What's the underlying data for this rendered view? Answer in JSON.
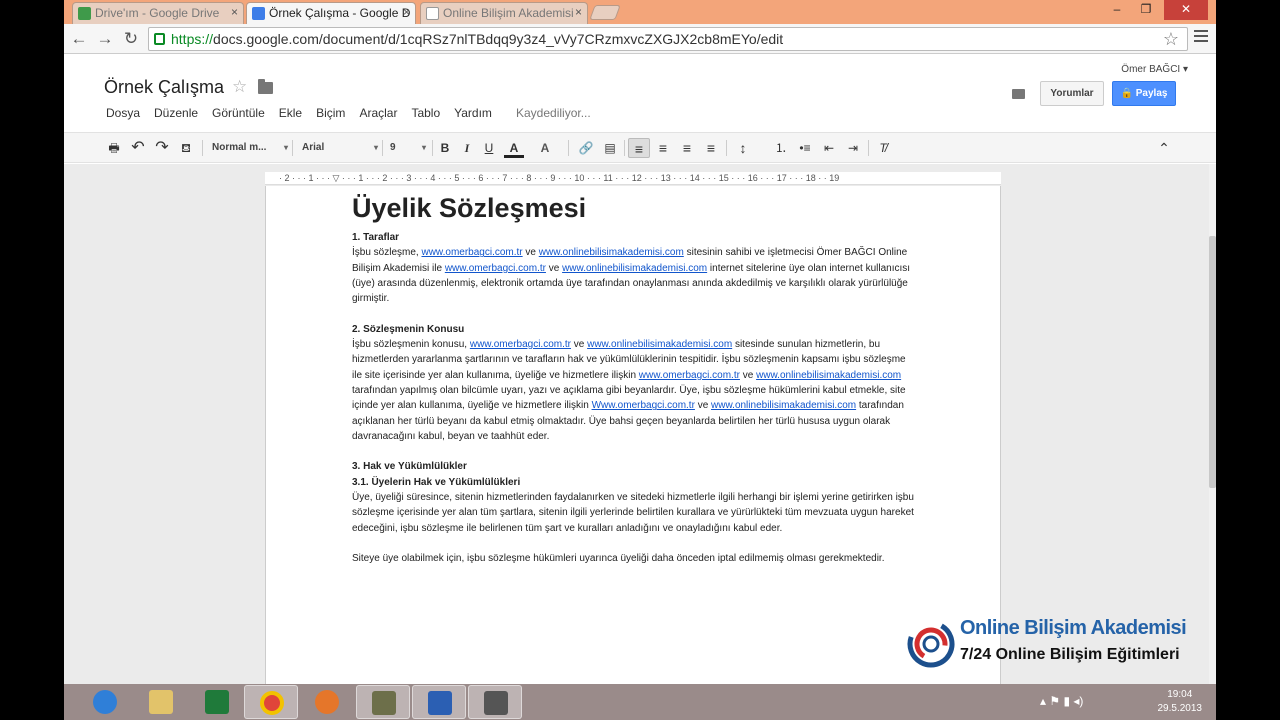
{
  "browser": {
    "tabs": [
      {
        "label": "Drive'ım - Google Drive",
        "close": "×"
      },
      {
        "label": "Örnek Çalışma - Google D",
        "close": "×"
      },
      {
        "label": "Online Bilişim Akademisi",
        "close": "×"
      }
    ],
    "window_controls": {
      "minimize": "–",
      "maximize": "❐",
      "close": "✕"
    },
    "nav": {
      "back": "←",
      "forward": "→",
      "reload": "↻"
    },
    "url_scheme": "https://",
    "url_rest": "docs.google.com/document/d/1cqRSz7nlTBdqq9y3z4_vVy7CRzmxvcZXGJX2cb8mEYo/edit",
    "bookmark_star": "☆"
  },
  "docs": {
    "title": "Örnek Çalışma",
    "title_star": "☆",
    "menu": [
      "Dosya",
      "Düzenle",
      "Görüntüle",
      "Ekle",
      "Biçim",
      "Araçlar",
      "Tablo",
      "Yardım"
    ],
    "save_status": "Kaydediliyor...",
    "user": "Ömer BAĞCI ▾",
    "comments_button": "Yorumlar",
    "share_button": "Paylaş"
  },
  "toolbar": {
    "print": "🖶",
    "undo": "↶",
    "redo": "↷",
    "paint_format": "⛾",
    "style": "Normal m...",
    "font": "Arial",
    "size": "9",
    "dropdown_arrow": "▾",
    "bold": "B",
    "italic": "I",
    "underline": "U",
    "text_color": "A",
    "highlight": "A",
    "link": "🔗",
    "comment": "▤",
    "align_left": "≡",
    "align_center": "≡",
    "align_right": "≡",
    "justify": "≡",
    "line_spacing": "↕",
    "numbered_list": "⒈",
    "bullet_list": "•≡",
    "decrease_indent": "⇤",
    "increase_indent": "⇥",
    "clear_format": "T̸",
    "collapse": "⌃"
  },
  "ruler": "· 2 · · · 1 · · · ▽ · · · 1 · · · 2 · · · 3 · · · 4 · · · 5 · · · 6 · · · 7 · · · 8 · · · 9 · · · 10 · · · 11 · · · 12 · · · 13 · · · 14 · · · 15 · · · 16 · · · 17 · · · 18 · · 19",
  "document": {
    "heading": "Üyelik Sözleşmesi",
    "s1_title": "1. Taraflar",
    "s1": {
      "a": "İşbu sözleşme, ",
      "l1": "www.omerbagci.com.tr",
      "b": " ve ",
      "l2": "www.onlinebilisimakademisi.com",
      "c": " sitesinin sahibi ve işletmecisi Ömer BAĞCI  Online Bilişim Akademisi ile ",
      "l3": "www.omerbagci.com.tr",
      "d": " ve ",
      "l4": "www.onlinebilisimakademisi.com",
      "e": " internet sitelerine üye olan internet kullanıcısı (üye) arasında düzenlenmiş, elektronik ortamda üye tarafından onaylanması anında akdedilmiş ve karşılıklı olarak yürürlülüğe girmiştir."
    },
    "s2_title": "2. Sözleşmenin Konusu",
    "s2": {
      "a": "İşbu sözleşmenin konusu, ",
      "l1": "www.omerbagci.com.tr",
      "b": " ve ",
      "l2": "www.onlinebilisimakademisi.com",
      "c": " sitesinde sunulan hizmetlerin, bu hizmetlerden yararlanma şartlarının ve tarafların hak ve yükümlülüklerinin tespitidir. İşbu sözleşmenin kapsamı işbu sözleşme ile site içerisinde yer alan kullanıma, üyeliğe ve hizmetlere ilişkin ",
      "l3": "www.omerbagci.com.tr",
      "d": " ve ",
      "l4": "www.onlinebilisimakademisi.com",
      "e": " tarafından yapılmış olan bilcümle uyarı, yazı ve açıklama gibi beyanlardır. Üye, işbu sözleşme hükümlerini kabul etmekle, site içinde yer alan kullanıma, üyeliğe ve hizmetlere ilişkin ",
      "l5": "Www.omerbagci.com.tr",
      "f": " ve ",
      "l6": "www.onlinebilisimakademisi.com",
      "g": "  tarafından açıklanan her türlü beyanı da kabul etmiş olmaktadır. Üye bahsi geçen beyanlarda belirtilen her türlü hususa uygun olarak davranacağını kabul, beyan ve taahhüt eder."
    },
    "s3_title": "3. Hak ve Yükümlülükler",
    "s31_title": "3.1. Üyelerin Hak ve Yükümlülükleri",
    "s31": "Üye, üyeliği süresince, sitenin hizmetlerinden faydalanırken ve sitedeki hizmetlerle ilgili herhangi bir işlemi yerine getirirken işbu sözleşme içerisinde yer alan tüm şartlara, sitenin ilgili yerlerinde belirtilen kurallara ve yürürlükteki tüm mevzuata uygun hareket edeceğini, işbu sözleşme ile belirlenen tüm şart ve kuralları anladığını ve onayladığını kabul eder.",
    "s31b": "Siteye üye olabilmek için, işbu sözleşme hükümleri uyarınca üyeliği daha önceden iptal edilmemiş olması gerekmektedir."
  },
  "watermark": {
    "line1": "Online Bilişim Akademisi",
    "line2": "7/24 Online Bilişim Eğitimleri"
  },
  "taskbar": {
    "tray": "▴  ⚑  ▮  ◂)",
    "time": "19:04",
    "date": "29.5.2013"
  },
  "colors": {
    "tab_strip": "#f3a57a",
    "share_button": "#4d90fe",
    "link": "#1155cc",
    "watermark_blue": "#2563a8",
    "taskbar": "#9a8b8a"
  }
}
